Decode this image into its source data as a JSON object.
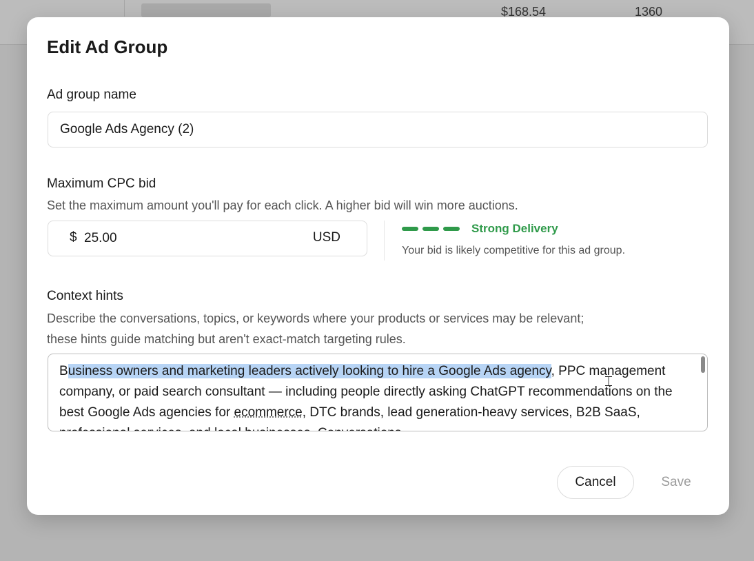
{
  "background": {
    "price": "$168.54",
    "count": "1360"
  },
  "modal": {
    "title": "Edit Ad Group",
    "ad_group_name": {
      "label": "Ad group name",
      "value": "Google Ads Agency (2)"
    },
    "max_cpc": {
      "label": "Maximum CPC bid",
      "help": "Set the maximum amount you'll pay for each click. A higher bid will win more auctions.",
      "currency_symbol": "$",
      "value": "25.00",
      "currency_code": "USD",
      "delivery_status": "Strong Delivery",
      "delivery_note": "Your bid is likely competitive for this ad group.",
      "delivery_level": 1.0,
      "delivery_color": "#2f9a4a"
    },
    "context_hints": {
      "label": "Context hints",
      "help_line1": "Describe the conversations, topics, or keywords where your products or services may be relevant;",
      "help_line2": "these hints guide matching but aren't exact-match targeting rules.",
      "text_pre": "B",
      "text_selected": "usiness owners and marketing leaders actively looking to hire a Google Ads agency",
      "text_mid": ", PPC management company, or paid search consultant — including people directly asking ChatGPT recommendations on the best Google Ads agencies for ",
      "text_misspelled": "ecommerce",
      "text_post": ", DTC brands, lead generation-heavy services, B2B SaaS, professional services, and local businesses. Conversations"
    },
    "buttons": {
      "cancel": "Cancel",
      "save": "Save"
    }
  },
  "colors": {
    "selection": "#b7d4f5",
    "success": "#2f9a4a",
    "disabled_text": "#9b9b9b"
  },
  "icons": {
    "text_cursor": "i-beam-cursor"
  }
}
